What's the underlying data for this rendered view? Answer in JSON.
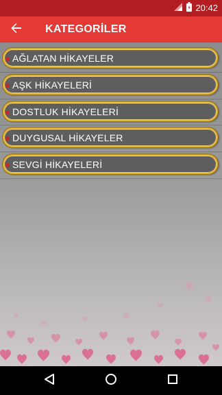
{
  "status_bar": {
    "time": "20:42",
    "icons": [
      "wifi-icon",
      "signal-icon",
      "battery-icon"
    ],
    "color": "#b21e22"
  },
  "app_bar": {
    "title": "KATEGORİLER",
    "back_icon": "back-arrow-icon",
    "color": "#e53935"
  },
  "categories": [
    {
      "label": "AĞLATAN HİKAYELER"
    },
    {
      "label": "AŞK HİKAYELERİ"
    },
    {
      "label": "DOSTLUK HİKAYELERİ"
    },
    {
      "label": "DUYGUSAL HİKAYELER"
    },
    {
      "label": "SEVGİ HİKAYELERİ"
    }
  ],
  "item_style": {
    "pill_color": "#5e5e5e",
    "border_color": "#e0b030",
    "dot_color": "#c62828"
  },
  "nav_bar": {
    "buttons": [
      "back-triangle-icon",
      "home-circle-icon",
      "recents-square-icon"
    ]
  }
}
